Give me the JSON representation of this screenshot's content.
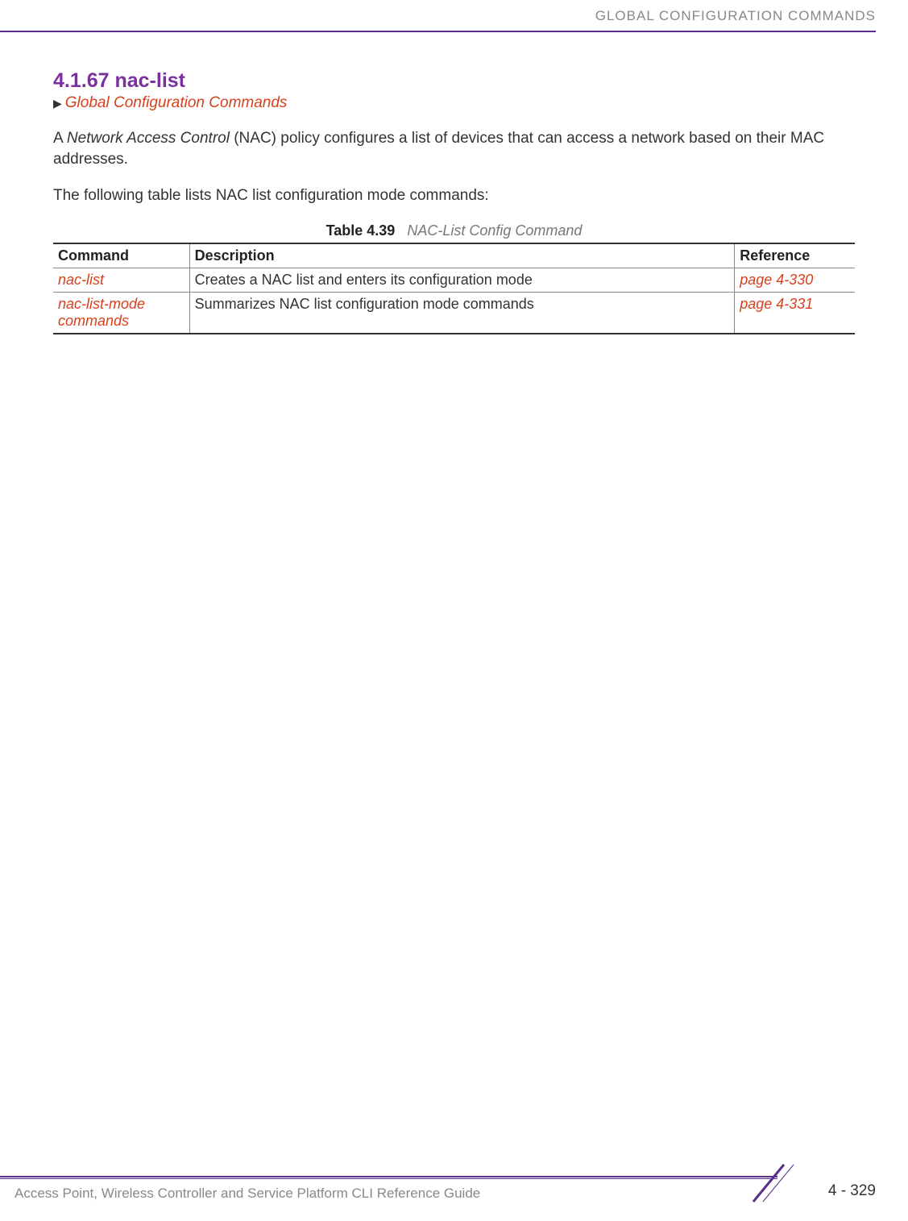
{
  "header": {
    "label": "GLOBAL CONFIGURATION COMMANDS"
  },
  "section": {
    "number": "4.1.67",
    "title": "nac-list",
    "breadcrumb": "Global Configuration Commands"
  },
  "paragraphs": {
    "p1_prefix": "A ",
    "p1_italic": "Network Access Control",
    "p1_suffix": " (NAC) policy configures a list of devices that can access a network based on their MAC addresses.",
    "p2": "The following table lists NAC list configuration mode commands:"
  },
  "table": {
    "caption_label": "Table 4.39",
    "caption_title": "NAC-List Config Command",
    "headers": {
      "command": "Command",
      "description": "Description",
      "reference": "Reference"
    },
    "rows": [
      {
        "command": "nac-list",
        "description": "Creates a NAC list and enters its configuration mode",
        "reference": "page 4-330"
      },
      {
        "command": "nac-list-mode commands",
        "description": "Summarizes NAC list configuration mode commands",
        "reference": "page 4-331"
      }
    ]
  },
  "footer": {
    "guide": "Access Point, Wireless Controller and Service Platform CLI Reference Guide",
    "page": "4 - 329"
  }
}
